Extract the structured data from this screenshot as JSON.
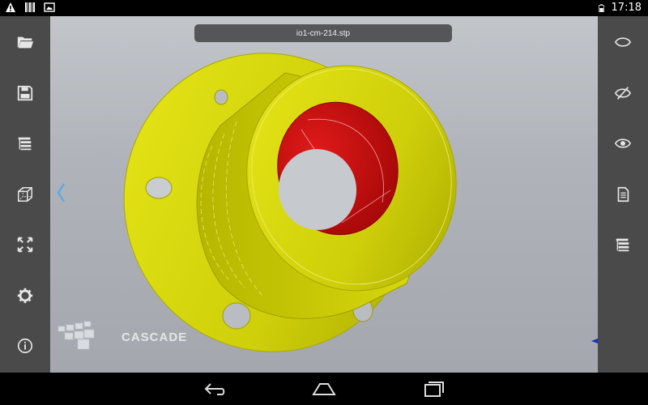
{
  "status_bar": {
    "time": "17:18",
    "icons": [
      "warning-icon",
      "barcode-icon",
      "image-icon",
      "battery-icon"
    ]
  },
  "left_toolbar": {
    "items": [
      "open-folder-icon",
      "save-icon",
      "tree-icon",
      "wireframe-cube-icon",
      "fit-all-icon",
      "settings-icon",
      "info-icon"
    ]
  },
  "right_toolbar": {
    "items": [
      "show-icon",
      "hide-icon",
      "show-only-icon",
      "document-icon",
      "tree-list-icon"
    ]
  },
  "viewer": {
    "file_name": "io1-cm-214.stp",
    "logo_text": "CASCADE",
    "part_color": "#d4d40c",
    "bore_color": "#c40a0a"
  },
  "nav_bar": {
    "items": [
      "back-icon",
      "home-icon",
      "recents-icon"
    ]
  }
}
